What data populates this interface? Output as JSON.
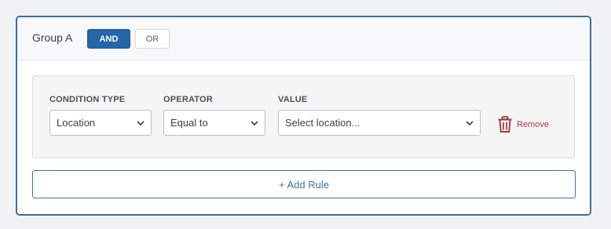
{
  "group": {
    "title": "Group A",
    "and_label": "AND",
    "or_label": "OR",
    "active_operator": "AND"
  },
  "rule": {
    "condition_type": {
      "label": "CONDITION TYPE",
      "value": "Location"
    },
    "operator": {
      "label": "OPERATOR",
      "value": "Equal to"
    },
    "value": {
      "label": "VALUE",
      "placeholder": "Select location..."
    },
    "remove_label": "Remove"
  },
  "add_rule_label": "+ Add Rule",
  "colors": {
    "accent": "#2466a8",
    "remove": "#a33a3a",
    "card_border": "#3d6f9a"
  },
  "icons": {
    "remove": "trash-icon",
    "dropdown": "chevron-down-icon"
  }
}
